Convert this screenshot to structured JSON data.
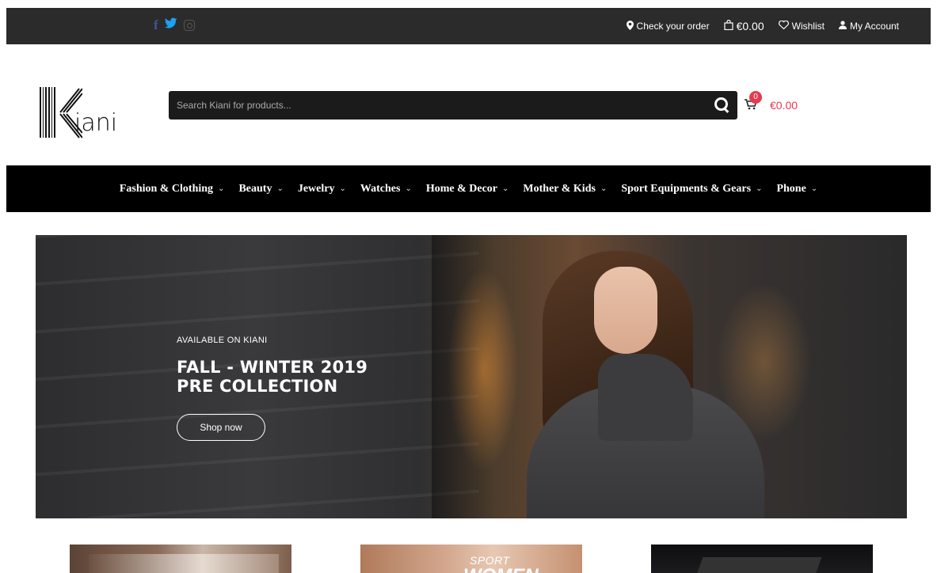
{
  "topbar": {
    "social": [
      {
        "name": "facebook-icon",
        "glyph": "f"
      },
      {
        "name": "twitter-icon",
        "glyph": "🐦"
      },
      {
        "name": "instagram-icon",
        "glyph": ""
      }
    ],
    "check_order": "Check your order",
    "cart_total": "€0.00",
    "wishlist": "Wishlist",
    "account": "My Account"
  },
  "header": {
    "logo_text": "iani",
    "search_placeholder": "Search Kiani for products...",
    "cart_count": "0",
    "cart_amount": "€0.00"
  },
  "nav": {
    "items": [
      {
        "label": "Fashion & Clothing"
      },
      {
        "label": "Beauty"
      },
      {
        "label": "Jewelry"
      },
      {
        "label": "Watches"
      },
      {
        "label": "Home & Decor"
      },
      {
        "label": "Mother & Kids"
      },
      {
        "label": "Sport Equipments & Gears"
      },
      {
        "label": "Phone"
      }
    ]
  },
  "hero": {
    "eyebrow": "AVAILABLE ON KIANI",
    "title_line1": "FALL - WINTER 2019",
    "title_line2": "PRE COLLECTION",
    "button": "Shop now"
  },
  "tiles": {
    "tile2_small": "SPORT",
    "tile2_big": "WOMEN"
  },
  "colors": {
    "topbar_bg": "#2b2b2b",
    "nav_bg": "#000000",
    "accent": "#e63950"
  }
}
